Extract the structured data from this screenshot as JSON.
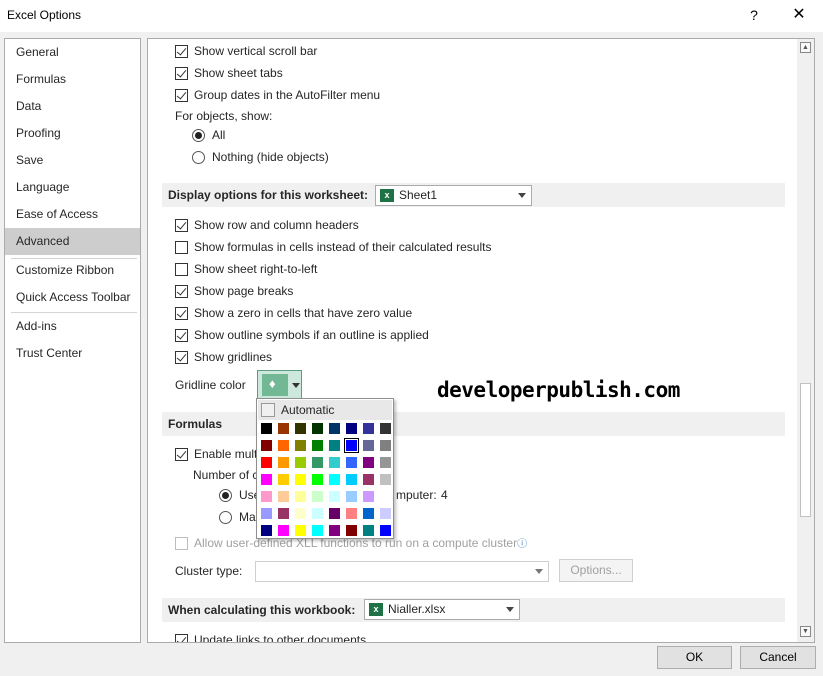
{
  "window": {
    "title": "Excel Options",
    "help_glyph": "?",
    "close_glyph": "✕"
  },
  "nav": {
    "items": [
      "General",
      "Formulas",
      "Data",
      "Proofing",
      "Save",
      "Language",
      "Ease of Access",
      "Advanced",
      "Customize Ribbon",
      "Quick Access Toolbar",
      "Add-ins",
      "Trust Center"
    ],
    "selected": "Advanced"
  },
  "workbook_display": {
    "show_vertical_scroll_bar": {
      "label": "Show vertical scroll bar",
      "checked": true
    },
    "show_sheet_tabs": {
      "label": "Show sheet tabs",
      "checked": true
    },
    "group_dates": {
      "label": "Group dates in the AutoFilter menu",
      "checked": true
    },
    "objects_label": "For objects, show:",
    "objects_all": {
      "label": "All",
      "selected": true
    },
    "objects_nothing": {
      "label": "Nothing (hide objects)",
      "selected": false
    }
  },
  "worksheet_display": {
    "section_label": "Display options for this worksheet:",
    "sheet_select": "Sheet1",
    "row_col_headers": {
      "label": "Show row and column headers",
      "checked": true
    },
    "formulas_in_cells": {
      "label": "Show formulas in cells instead of their calculated results",
      "checked": false
    },
    "right_to_left": {
      "label": "Show sheet right-to-left",
      "checked": false
    },
    "page_breaks": {
      "label": "Show page breaks",
      "checked": true
    },
    "zero_values": {
      "label": "Show a zero in cells that have zero value",
      "checked": true
    },
    "outline_symbols": {
      "label": "Show outline symbols if an outline is applied",
      "checked": true
    },
    "gridlines": {
      "label": "Show gridlines",
      "checked": true
    },
    "gridline_color_label": "Gridline color",
    "gridline_color_value": "#73b895"
  },
  "formulas": {
    "section_label": "Formulas",
    "enable_multithreaded": {
      "label": "Enable mult",
      "checked": true
    },
    "number_of": "Number of c",
    "use_all_processors": {
      "label": "Use",
      "suffix": "mputer:",
      "count": "4",
      "selected": true
    },
    "manual": {
      "label": "Ma",
      "selected": false
    },
    "allow_xll": {
      "label": "Allow user-defined XLL functions to run on a compute cluster",
      "checked": false,
      "info_glyph": "ⓘ"
    },
    "cluster_type_label": "Cluster type:",
    "options_button": "Options..."
  },
  "calculating": {
    "section_label": "When calculating this workbook:",
    "workbook_select": "Nialler.xlsx",
    "update_links": {
      "label": "Update links to other documents",
      "checked": true
    }
  },
  "color_palette": {
    "automatic_label": "Automatic",
    "selected_index": 13,
    "colors": [
      "#000000",
      "#993300",
      "#333300",
      "#003300",
      "#003366",
      "#000080",
      "#333399",
      "#333333",
      "#800000",
      "#ff6600",
      "#808000",
      "#008000",
      "#008080",
      "#0000ff",
      "#666699",
      "#808080",
      "#ff0000",
      "#ff9900",
      "#99cc00",
      "#339966",
      "#33cccc",
      "#3366ff",
      "#800080",
      "#969696",
      "#ff00ff",
      "#ffcc00",
      "#ffff00",
      "#00ff00",
      "#00ffff",
      "#00ccff",
      "#993366",
      "#c0c0c0",
      "#ff99cc",
      "#ffcc99",
      "#ffff99",
      "#ccffcc",
      "#ccffff",
      "#99ccff",
      "#cc99ff",
      "#ffffff",
      "#9999ff",
      "#993366",
      "#ffffcc",
      "#ccffff",
      "#660066",
      "#ff8080",
      "#0066cc",
      "#ccccff",
      "#000080",
      "#ff00ff",
      "#ffff00",
      "#00ffff",
      "#800080",
      "#800000",
      "#008080",
      "#0000ff"
    ]
  },
  "watermark": "developerpublish.com",
  "footer": {
    "ok": "OK",
    "cancel": "Cancel"
  }
}
